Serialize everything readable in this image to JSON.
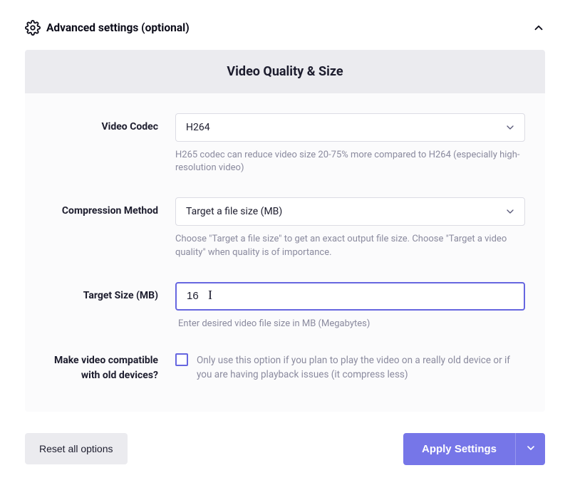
{
  "header": {
    "title": "Advanced settings (optional)"
  },
  "section": {
    "title": "Video Quality & Size"
  },
  "fields": {
    "codec": {
      "label": "Video Codec",
      "value": "H264",
      "hint": "H265 codec can reduce video size 20-75% more compared to H264 (especially high-resolution video)"
    },
    "compression": {
      "label": "Compression Method",
      "value": "Target a file size (MB)",
      "hint": "Choose \"Target a file size\" to get an exact output file size. Choose \"Target a video quality\" when quality is of importance."
    },
    "targetSize": {
      "label": "Target Size (MB)",
      "value": "16",
      "hint": "Enter desired video file size in MB (Megabytes)"
    },
    "compat": {
      "label": "Make video compatible with old devices?",
      "desc": "Only use this option if you plan to play the video on a really old device or if you are having playback issues (it compress less)"
    }
  },
  "footer": {
    "reset": "Reset all options",
    "apply": "Apply Settings"
  }
}
